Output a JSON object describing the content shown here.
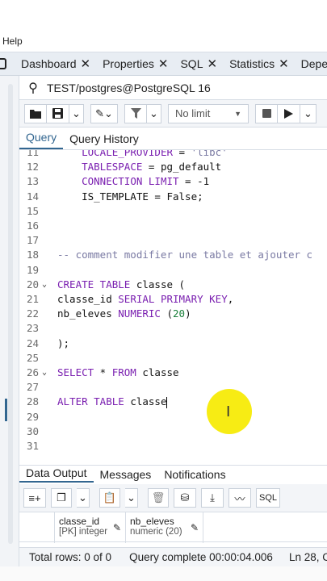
{
  "menubar": {
    "help_label": "Help"
  },
  "tabs": [
    {
      "label": "Dashboard",
      "close": "✕"
    },
    {
      "label": "Properties",
      "close": "✕"
    },
    {
      "label": "SQL",
      "close": "✕"
    },
    {
      "label": "Statistics",
      "close": "✕"
    },
    {
      "label": "Depend",
      "close": ""
    }
  ],
  "connection": {
    "label": "TEST/postgres@PostgreSQL 16"
  },
  "toolbar": {
    "limit_label": "No limit",
    "limit_caret": "▼"
  },
  "query_tabs": [
    {
      "label": "Query"
    },
    {
      "label": "Query History"
    }
  ],
  "editor": {
    "lines": [
      {
        "n": "11",
        "fold": "",
        "html": "    <span class=\"kw\">LOCALE_PROVIDER</span> = <span class=\"cm\">'libc'</span>"
      },
      {
        "n": "12",
        "fold": "",
        "html": "    <span class=\"kw\">TABLESPACE</span> = pg_default"
      },
      {
        "n": "13",
        "fold": "",
        "html": "    <span class=\"kw\">CONNECTION LIMIT</span> = -1"
      },
      {
        "n": "14",
        "fold": "",
        "html": "    IS_TEMPLATE = False;"
      },
      {
        "n": "15",
        "fold": "",
        "html": ""
      },
      {
        "n": "16",
        "fold": "",
        "html": ""
      },
      {
        "n": "17",
        "fold": "",
        "html": ""
      },
      {
        "n": "18",
        "fold": "",
        "html": "<span class=\"cm\">-- comment modifier une table et ajouter c</span>"
      },
      {
        "n": "19",
        "fold": "",
        "html": ""
      },
      {
        "n": "20",
        "fold": "⌄",
        "html": "<span class=\"kw\">CREATE TABLE</span> classe ("
      },
      {
        "n": "21",
        "fold": "",
        "html": "classe_id <span class=\"kw\">SERIAL PRIMARY KEY</span>,"
      },
      {
        "n": "22",
        "fold": "",
        "html": "nb_eleves <span class=\"kw\">NUMERIC</span> (<span class=\"nm\">20</span>)"
      },
      {
        "n": "23",
        "fold": "",
        "html": ""
      },
      {
        "n": "24",
        "fold": "",
        "html": ");"
      },
      {
        "n": "25",
        "fold": "",
        "html": ""
      },
      {
        "n": "26",
        "fold": "⌄",
        "html": "<span class=\"kw\">SELECT</span> * <span class=\"kw\">FROM</span> classe"
      },
      {
        "n": "27",
        "fold": "",
        "html": ""
      },
      {
        "n": "28",
        "fold": "",
        "html": "<span class=\"kw\">ALTER TABLE</span> classe<span class=\"caret\"></span>"
      },
      {
        "n": "29",
        "fold": "",
        "html": ""
      },
      {
        "n": "30",
        "fold": "",
        "html": ""
      },
      {
        "n": "31",
        "fold": "",
        "html": ""
      }
    ]
  },
  "result_tabs": [
    {
      "label": "Data Output"
    },
    {
      "label": "Messages"
    },
    {
      "label": "Notifications"
    }
  ],
  "results_toolbar": {
    "sql_label": "SQL"
  },
  "grid": {
    "columns": [
      {
        "name": "classe_id",
        "type": "[PK] integer"
      },
      {
        "name": "nb_eleves",
        "type": "numeric (20)"
      }
    ]
  },
  "status": {
    "rows": "Total rows: 0 of 0",
    "query": "Query complete 00:00:04.006",
    "position": "Ln 28, C"
  },
  "colors": {
    "accent": "#326690",
    "keyword": "#7a1fb0",
    "cursor_highlight": "#f7ec14"
  }
}
